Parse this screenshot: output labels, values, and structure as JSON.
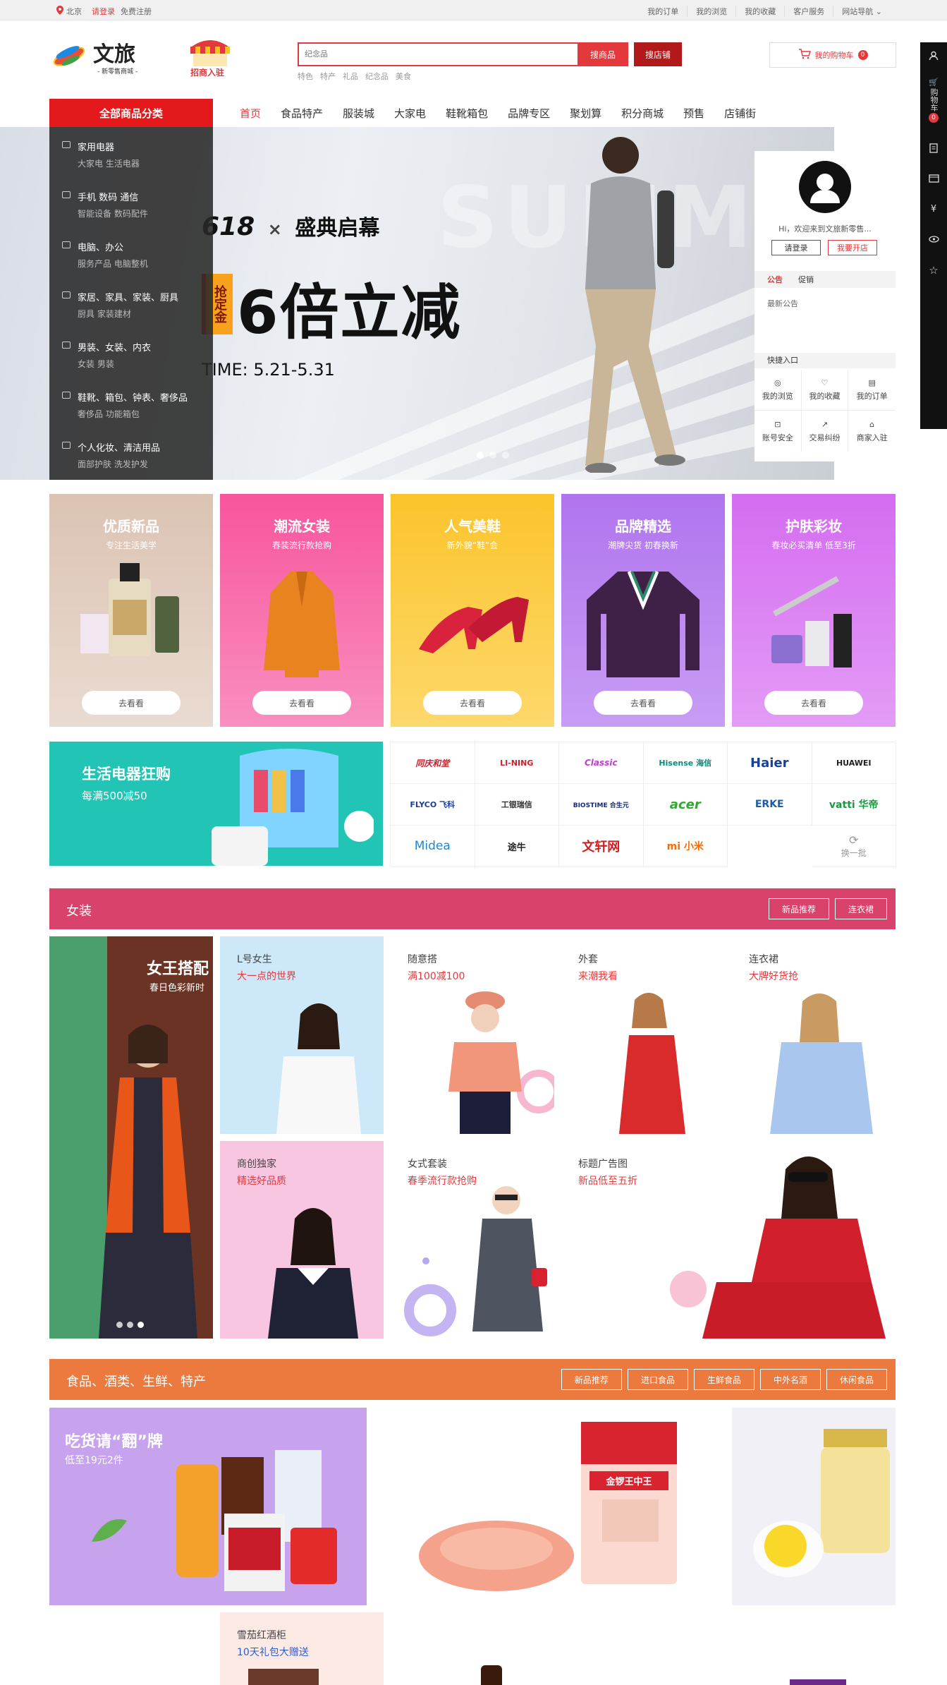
{
  "topbar": {
    "location": "北京",
    "login": "请登录",
    "register": "免费注册",
    "links": [
      "我的订单",
      "我的浏览",
      "我的收藏",
      "客户服务",
      "网站导航"
    ]
  },
  "logo": {
    "name": "文旅",
    "slogan": "- 新零售商城 -",
    "merchant_badge": "招商入驻"
  },
  "search": {
    "placeholder": "纪念品",
    "btn_goods": "搜商品",
    "btn_shop": "搜店铺",
    "hot": [
      "特色",
      "特产",
      "礼品",
      "纪念品",
      "美食"
    ]
  },
  "cart": {
    "label": "我的购物车",
    "count": "0"
  },
  "rightbar": {
    "cart_label": "购物车",
    "cart_count": "0"
  },
  "nav": {
    "all": "全部商品分类",
    "items": [
      "首页",
      "食品特产",
      "服装城",
      "大家电",
      "鞋靴箱包",
      "品牌专区",
      "聚划算",
      "积分商城",
      "预售",
      "店铺街"
    ]
  },
  "categories": [
    {
      "title": "家用电器",
      "sub": "大家电   生活电器"
    },
    {
      "title": "手机   数码   通信",
      "sub": "智能设备   数码配件"
    },
    {
      "title": "电脑、办公",
      "sub": "服务产品   电脑整机"
    },
    {
      "title": "家居、家具、家装、厨具",
      "sub": "厨具   家装建材"
    },
    {
      "title": "男装、女装、内衣",
      "sub": "女装   男装"
    },
    {
      "title": "鞋靴、箱包、钟表、奢侈品",
      "sub": "奢侈品   功能箱包"
    },
    {
      "title": "个人化妆、清洁用品",
      "sub": "面部护肤   洗发护发"
    }
  ],
  "banner": {
    "line1": "618",
    "line1b": "盛典启幕",
    "tag": "抢定金",
    "big": "6倍立减",
    "time": "TIME: 5.21-5.31",
    "bg_text": "SUMMER"
  },
  "user": {
    "welcome": "Hi，欢迎来到文旅新零售...",
    "login": "请登录",
    "open_shop": "我要开店",
    "tab1": "公告",
    "tab2": "促销",
    "notice": "最新公告",
    "quick_title": "快捷入口",
    "quick": [
      "我的浏览",
      "我的收藏",
      "我的订单",
      "账号安全",
      "交易纠纷",
      "商家入驻"
    ]
  },
  "promos": [
    {
      "title": "优质新品",
      "sub": "专注生活美学",
      "go": "去看看",
      "color": "#ddc2b2"
    },
    {
      "title": "潮流女装",
      "sub": "春装流行款抢购",
      "go": "去看看",
      "color": "#f56fa8"
    },
    {
      "title": "人气美鞋",
      "sub": "新外貌“鞋”会",
      "go": "去看看",
      "color": "#fccb3b"
    },
    {
      "title": "品牌精选",
      "sub": "潮牌尖货 初春换新",
      "go": "去看看",
      "color": "#b77ef0"
    },
    {
      "title": "护肤彩妆",
      "sub": "春妆必买清单 低至3折",
      "go": "去看看",
      "color": "#d77cf0"
    }
  ],
  "appliance": {
    "title": "生活电器狂购",
    "sub": "每满500减50"
  },
  "brands": [
    "同庆和堂",
    "LI-NING",
    "Classic",
    "Hisense 海信",
    "Haier",
    "HUAWEI",
    "FLYCO 飞科",
    "工银瑞信",
    "BIOSTIME 合生元",
    "acer",
    "ERKE",
    "vatti 华帝",
    "Midea",
    "途牛",
    "文轩网",
    "mi 小米",
    "换一批"
  ],
  "floor1": {
    "title": "女装",
    "tabs": [
      "新品推荐",
      "连衣裙"
    ],
    "big": {
      "title": "女王搭配",
      "sub": "春日色彩新时"
    },
    "tiles": [
      {
        "a": "L号女生",
        "b": "大一点的世界"
      },
      {
        "a": "随意搭",
        "b": "满100减100"
      },
      {
        "a": "外套",
        "b": "来潮我看"
      },
      {
        "a": "连衣裙",
        "b": "大牌好货抢"
      },
      {
        "a": "商创独家",
        "b": "精选好品质"
      },
      {
        "a": "女式套装",
        "b": "春季流行款抢购"
      },
      {
        "a": "标题广告图",
        "b": "新品低至五折"
      }
    ]
  },
  "floor2": {
    "title": "食品、酒类、生鲜、特产",
    "tabs": [
      "新品推荐",
      "进口食品",
      "生鲜食品",
      "中外名酒",
      "休闲食品"
    ],
    "big": {
      "title": "吃货请“翻”牌",
      "sub": "低至19元2件"
    },
    "sausage": "金锣王中王",
    "tile": {
      "a": "雪茄红酒柜",
      "b": "10天礼包大赠送"
    }
  },
  "colors": {
    "accent": "#e4393c",
    "floor1": "#d9426a",
    "floor2": "#ec7a3e",
    "appliance": "#22c5b5"
  }
}
